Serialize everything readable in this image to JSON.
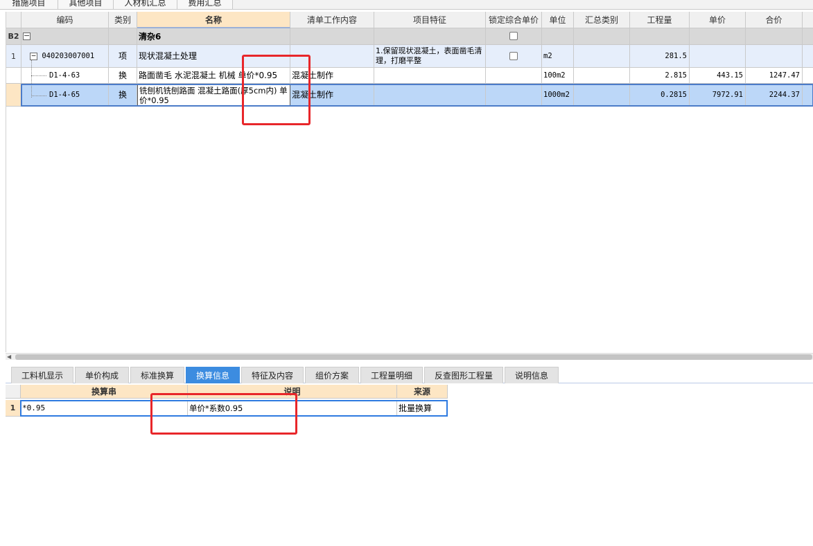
{
  "top_tabs": [
    "措施项目",
    "其他项目",
    "人材机汇总",
    "费用汇总"
  ],
  "main_grid": {
    "columns": [
      "编码",
      "类别",
      "名称",
      "清单工作内容",
      "项目特征",
      "锁定综合单价",
      "单位",
      "汇总类别",
      "工程量",
      "单价",
      "合价"
    ],
    "rows": [
      {
        "row_label": "B2",
        "code": "",
        "category": "",
        "name": "清杂6",
        "work_content": "",
        "feature": "",
        "unit": "",
        "summary_cat": "",
        "quantity": "",
        "unit_price": "",
        "total": ""
      },
      {
        "row_label": "1",
        "code": "040203007001",
        "category": "项",
        "name": "现状混凝土处理",
        "work_content": "",
        "feature": "1.保留现状混凝土，表面凿毛清理，打磨平整",
        "unit": "m2",
        "summary_cat": "",
        "quantity": "281.5",
        "unit_price": "",
        "total": ""
      },
      {
        "row_label": "",
        "code": "D1-4-63",
        "category": "换",
        "name": "路面凿毛 水泥混凝土 机械  单价*0.95",
        "work_content": "混凝土制作",
        "feature": "",
        "unit": "100m2",
        "summary_cat": "",
        "quantity": "2.815",
        "unit_price": "443.15",
        "total": "1247.47"
      },
      {
        "row_label": "",
        "code": "D1-4-65",
        "category": "换",
        "name": "铣刨机铣刨路面 混凝土路面(厚5cm内) 单价*0.95",
        "work_content": "混凝土制作",
        "feature": "",
        "unit": "1000m2",
        "summary_cat": "",
        "quantity": "0.2815",
        "unit_price": "7972.91",
        "total": "2244.37"
      }
    ]
  },
  "bottom_tabs": [
    "工料机显示",
    "单价构成",
    "标准换算",
    "换算信息",
    "特征及内容",
    "组价方案",
    "工程量明细",
    "反查图形工程量",
    "说明信息"
  ],
  "active_bottom_tab": "换算信息",
  "sub_grid": {
    "columns": [
      "换算串",
      "说明",
      "来源"
    ],
    "rows": [
      {
        "row_label": "1",
        "expr": "*0.95",
        "desc": "单价*系数0.95",
        "source": "批量换算"
      }
    ]
  },
  "colors": {
    "highlight_red": "#e8262a",
    "selected_row": "#bcd7f8",
    "active_tab": "#3c8ce0",
    "header_accent": "#fde6c4"
  }
}
